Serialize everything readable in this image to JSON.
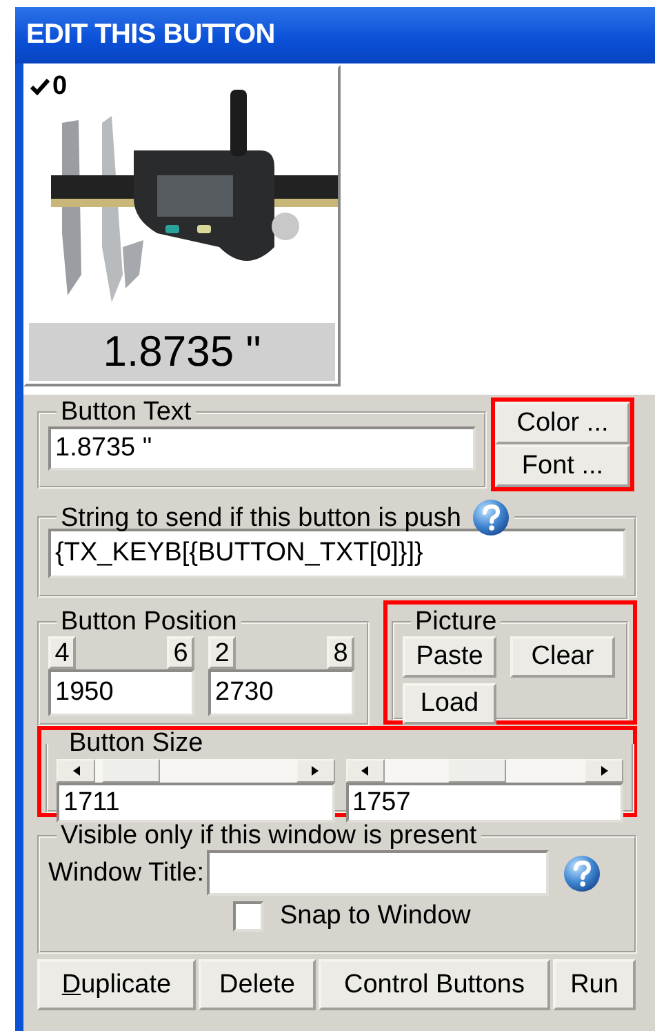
{
  "window": {
    "title": "EDIT THIS BUTTON"
  },
  "preview": {
    "checked": true,
    "number": "0",
    "caption": "1.8735 \""
  },
  "button_text": {
    "label": "Button Text",
    "value": "1.8735 \""
  },
  "style_buttons": {
    "highlighted": true,
    "buttons": [
      "Color ...",
      "Font ..."
    ]
  },
  "string_to_send": {
    "label": "String to send if this button is push",
    "value": "{TX_KEYB[{BUTTON_TXT[0]}]}"
  },
  "button_position": {
    "label": "Button Position",
    "axes": [
      {
        "keys": [
          "4",
          "6"
        ],
        "value": "1950"
      },
      {
        "keys": [
          "2",
          "8"
        ],
        "value": "2730"
      }
    ]
  },
  "picture": {
    "label": "Picture",
    "highlighted": true,
    "buttons": [
      "Paste",
      "Clear",
      "Load"
    ]
  },
  "button_size": {
    "label": "Button Size",
    "highlighted": true,
    "sliders": [
      {
        "level": 0.05,
        "value": "1711"
      },
      {
        "level": 0.45,
        "value": "1757"
      }
    ]
  },
  "visibility": {
    "label": "Visible only if this window is present",
    "window_title_label": "Window Title:",
    "snap": {
      "label": "Snap to Window",
      "checked": false
    }
  },
  "actions": [
    {
      "label": "Duplicate",
      "mnemonic": true
    },
    {
      "label": "Delete",
      "mnemonic": false
    },
    {
      "label": "Control Buttons",
      "mnemonic": false
    },
    {
      "label": "Run",
      "mnemonic": false
    }
  ]
}
